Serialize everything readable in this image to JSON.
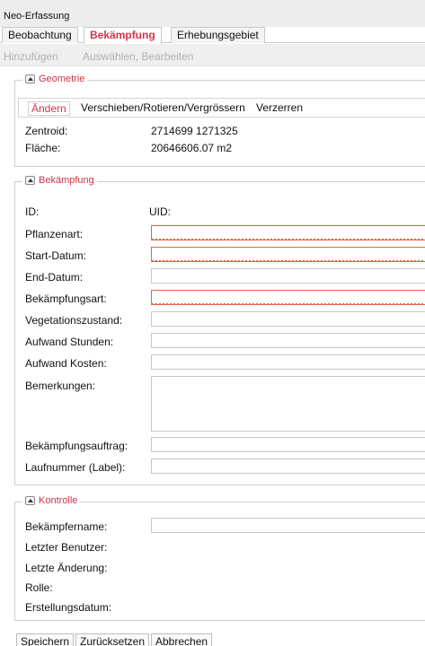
{
  "window": {
    "title": "Neo-Erfassung"
  },
  "tabs": [
    {
      "label": "Beobachtung",
      "active": false
    },
    {
      "label": "Bekämpfung",
      "active": true
    },
    {
      "label": "Erhebungsgebiet",
      "active": false
    }
  ],
  "toolbar": {
    "add_label": "Hinzufügen",
    "edit_label": "Auswählen, Bearbeiten"
  },
  "geometrie": {
    "legend": "Geometrie",
    "buttons": [
      "Ändern",
      "Verschieben/Rotieren/Vergrössern",
      "Verzerren"
    ],
    "zentroid_label": "Zentroid:",
    "zentroid_value": "2714699 1271325",
    "flaeche_label": "Fläche:",
    "flaeche_value": "20646606.07 m2"
  },
  "bekaempfung": {
    "legend": "Bekämpfung",
    "id_label": "ID:",
    "uid_label": "UID:",
    "fields": [
      {
        "label": "Pflanzenart:",
        "value": "",
        "required": true
      },
      {
        "label": "Start-Datum:",
        "value": "",
        "required": true
      },
      {
        "label": "End-Datum:",
        "value": "",
        "required": false
      },
      {
        "label": "Bekämpfungsart:",
        "value": "",
        "required": true
      },
      {
        "label": "Vegetationszustand:",
        "value": "",
        "required": false
      },
      {
        "label": "Aufwand Stunden:",
        "value": "",
        "required": false
      },
      {
        "label": "Aufwand Kosten:",
        "value": "",
        "required": false
      }
    ],
    "bemerkungen_label": "Bemerkungen:",
    "bemerkungen_value": "",
    "auftrag_label": "Bekämpfungsauftrag:",
    "laufnummer_label": "Laufnummer (Label):"
  },
  "kontrolle": {
    "legend": "Kontrolle",
    "bekaempfername_label": "Bekämpfername:",
    "letzter_benutzer_label": "Letzter Benutzer:",
    "letzte_aenderung_label": "Letzte Änderung:",
    "rolle_label": "Rolle:",
    "erstellungsdatum_label": "Erstellungsdatum:"
  },
  "footer": {
    "save_label": "Speichern",
    "reset_label": "Zurücksetzen",
    "cancel_label": "Abbrechen"
  },
  "colors": {
    "accent": "#d1334b",
    "required_border": "#e0663f"
  }
}
